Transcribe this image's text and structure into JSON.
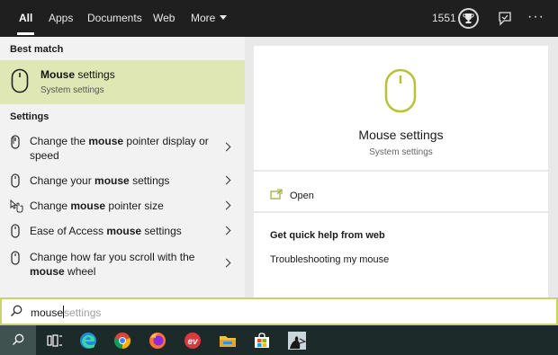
{
  "tabs": [
    {
      "label": "All",
      "active": true
    },
    {
      "label": "Apps"
    },
    {
      "label": "Documents"
    },
    {
      "label": "Web"
    },
    {
      "label": "More"
    }
  ],
  "header": {
    "points": "1551",
    "icons": [
      "trophy-icon",
      "feedback-icon",
      "more-options-icon"
    ]
  },
  "best_match": {
    "header": "Best match",
    "title_bold": "Mouse",
    "title_rest": " settings",
    "subtitle": "System settings",
    "icon": "mouse-icon"
  },
  "settings": {
    "header": "Settings",
    "items": [
      {
        "pre": "Change the ",
        "bold": "mouse",
        "post": " pointer display or speed",
        "icon": "mouse-pointer-icon"
      },
      {
        "pre": "Change your ",
        "bold": "mouse",
        "post": " settings",
        "icon": "mouse-icon"
      },
      {
        "pre": "Change ",
        "bold": "mouse",
        "post": " pointer size",
        "icon": "pointer-size-icon"
      },
      {
        "pre": "Ease of Access ",
        "bold": "mouse",
        "post": " settings",
        "icon": "mouse-icon"
      },
      {
        "pre": "Change how far you scroll with the ",
        "bold": "mouse",
        "post": " wheel",
        "icon": "mouse-icon"
      }
    ]
  },
  "detail": {
    "title": "Mouse settings",
    "subtitle": "System settings",
    "open_label": "Open",
    "help_header": "Get quick help from web",
    "help_link": "Troubleshooting my mouse"
  },
  "search": {
    "typed": "mouse",
    "suggestion": "settings"
  },
  "taskbar": {
    "items": [
      "search-icon",
      "task-view-icon",
      "edge-icon",
      "chrome-icon",
      "firefox-icon",
      "expressvpn-icon",
      "file-explorer-icon",
      "store-icon",
      "kindle-icon"
    ]
  },
  "colors": {
    "accent": "#c8d46a",
    "selection": "#dfe8b4",
    "topbar": "#1f1f1f",
    "taskbar": "#1c2a2a"
  }
}
